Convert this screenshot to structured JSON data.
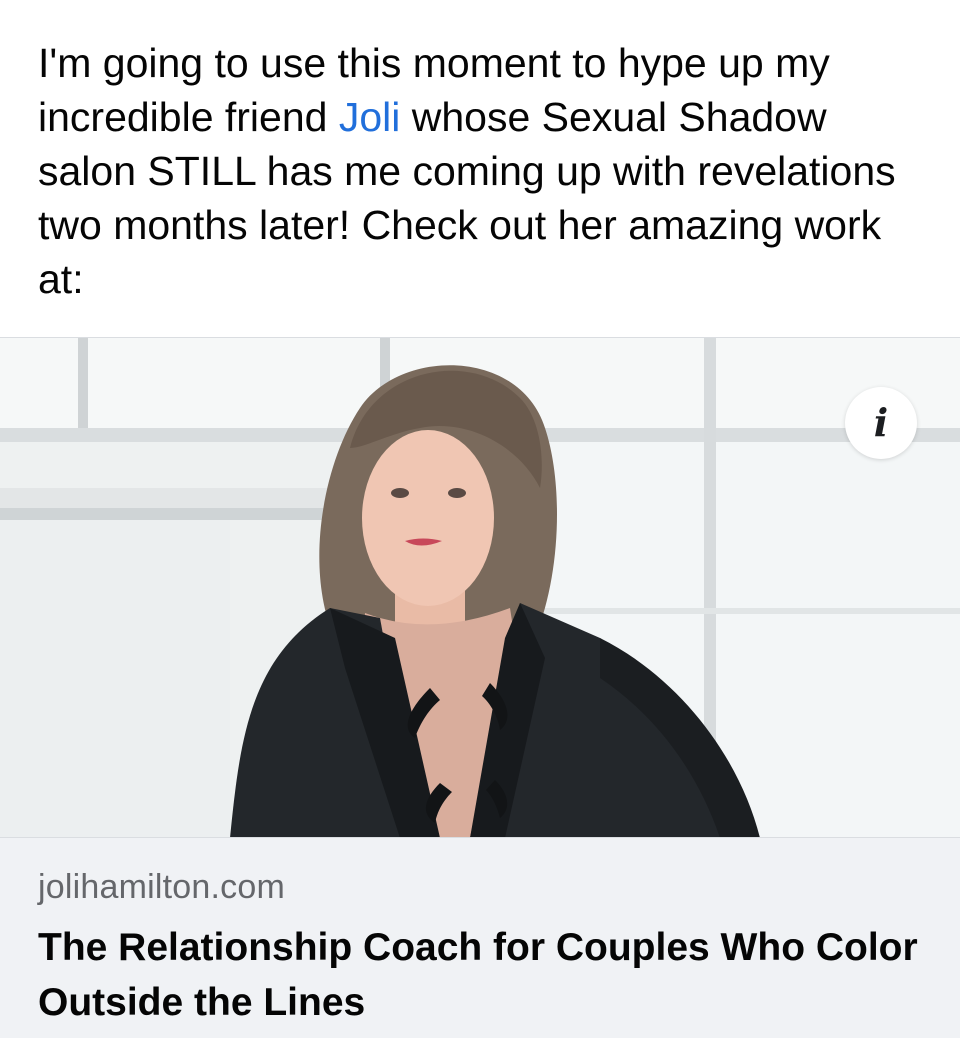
{
  "post": {
    "text_before": "I'm going to use this moment to hype up my incredible friend ",
    "mention": "Joli",
    "text_after": " whose Sexual Shadow salon STILL has me coming up with revelations two months later! Check out her amazing work at:"
  },
  "link_preview": {
    "domain": "jolihamilton.com",
    "title": "The Relationship Coach for Couples Who Color Outside the Lines",
    "info_icon": "info-icon",
    "image_alt": "Portrait of a woman in a black blazer against a bright window"
  },
  "colors": {
    "mention": "#216fdb",
    "footer_bg": "#f0f2f5",
    "domain_text": "#65676b",
    "body_text": "#050505"
  }
}
